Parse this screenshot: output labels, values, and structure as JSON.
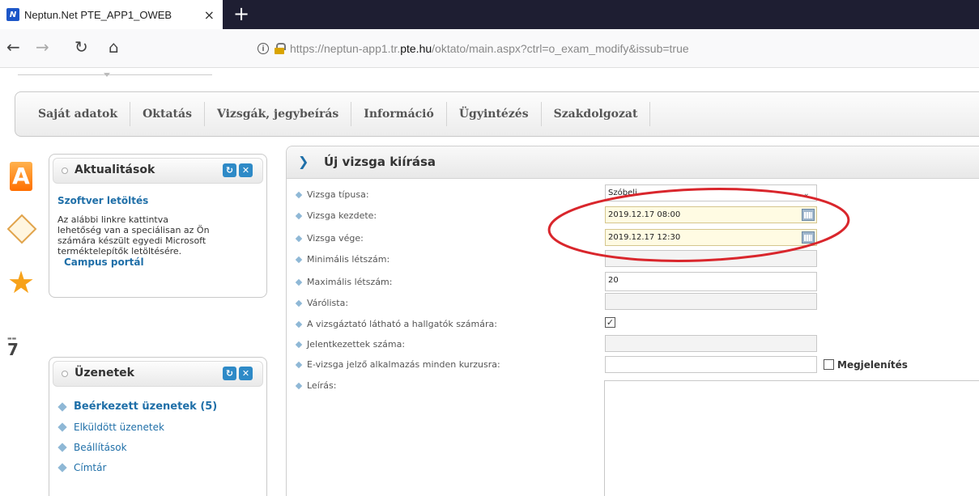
{
  "browser": {
    "tab_title": "Neptun.Net PTE_APP1_OWEB",
    "tab_close": "×",
    "new_tab": "+",
    "favicon_letter": "N",
    "url_prefix": "https://neptun-app1.tr.",
    "url_host": "pte.hu",
    "url_suffix": "/oktato/main.aspx?ctrl=o_exam_modify&issub=true"
  },
  "menu": [
    "Saját adatok",
    "Oktatás",
    "Vizsgák, jegybeírás",
    "Információ",
    "Ügyintézés",
    "Szakdolgozat"
  ],
  "side": {
    "a_letter": "A",
    "star": "★",
    "cal_number": "7"
  },
  "panel_news": {
    "title": "Aktualitások",
    "link": "Szoftver letöltés",
    "text_lines": [
      "Az alábbi linkre kattintva",
      "lehetőség van a speciálisan az Ön",
      "számára készült egyedi Microsoft",
      "terméktelepítők letöltésére."
    ],
    "link2": "Campus portál"
  },
  "panel_messages": {
    "title": "Üzenetek",
    "items": [
      "Beérkezett üzenetek (5)",
      "Elküldött üzenetek",
      "Beállítások",
      "Címtár"
    ]
  },
  "form": {
    "title": "Új vizsga kiírása",
    "labels": [
      "Vizsga típusa:",
      "Vizsga kezdete:",
      "Vizsga vége:",
      "Minimális létszám:",
      "Maximális létszám:",
      "Várólista:",
      "A vizsgáztató látható a hallgatók számára:",
      "Jelentkezettek száma:",
      "E-vizsga jelző alkalmazás minden kurzusra:",
      "Leírás:"
    ],
    "exam_type": "Szóbeli",
    "start": "2019.12.17 08:00",
    "end": "2019.12.17 12:30",
    "max_count": "20",
    "examiner_visible": true,
    "megjelenites_label": "Megjelenítés"
  },
  "colors": {
    "annotation": "#d9262c",
    "link": "#1f6fa8"
  }
}
